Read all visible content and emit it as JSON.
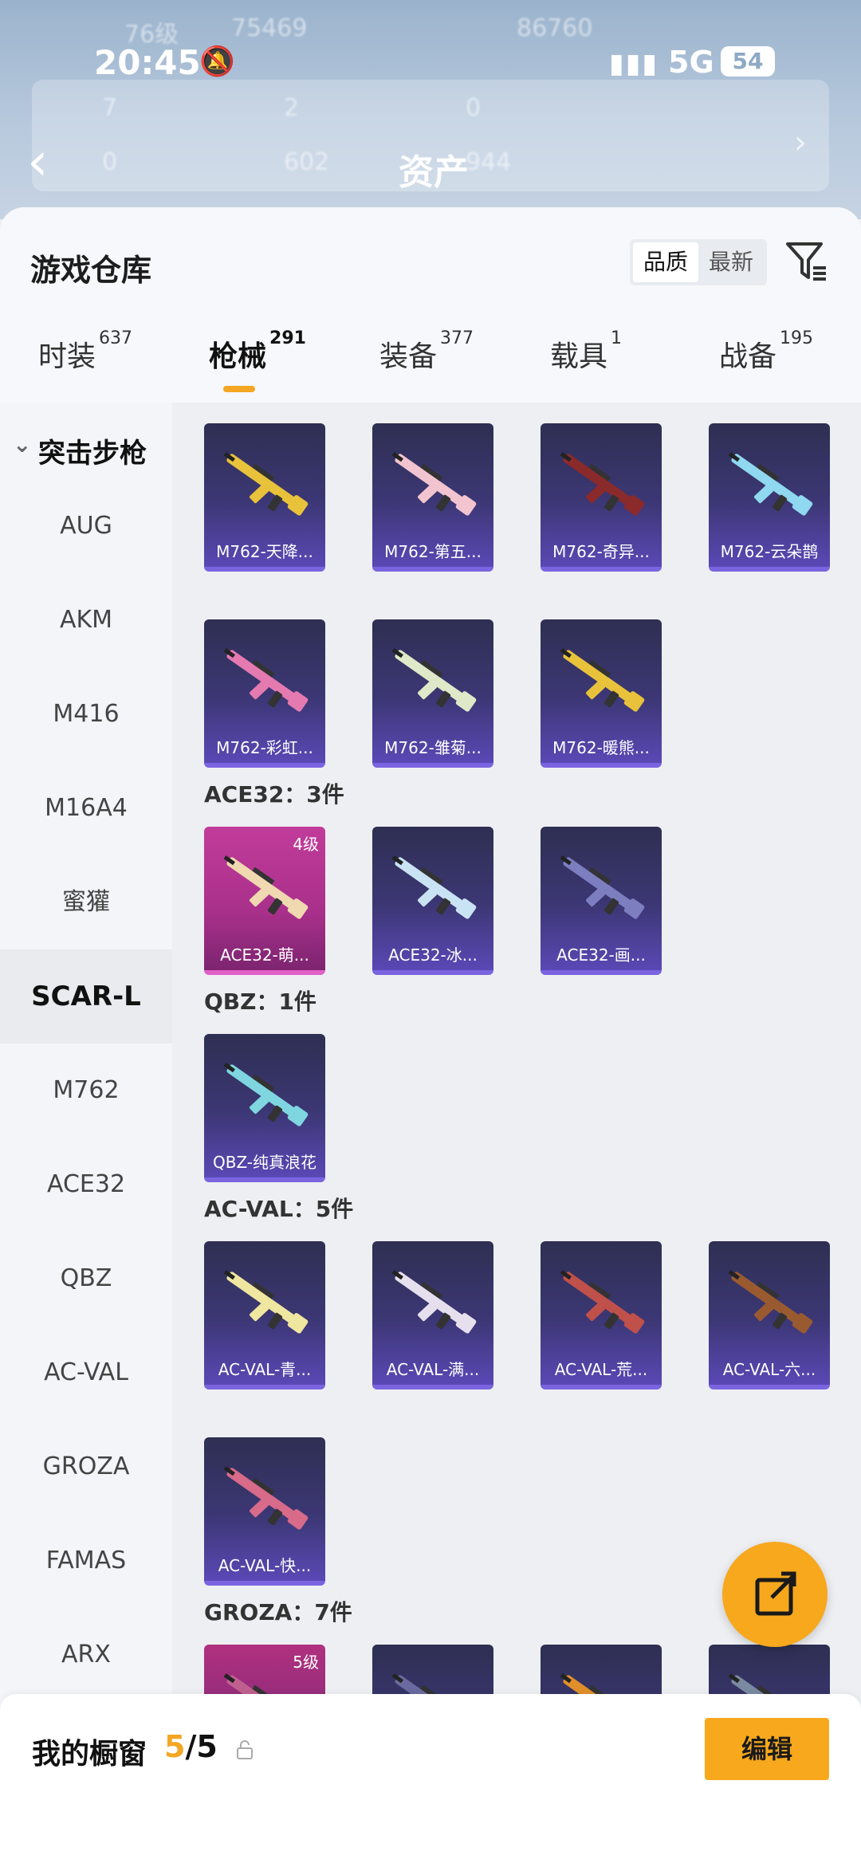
{
  "status_bar": {
    "time": "20:45",
    "network": "5G",
    "battery": "54"
  },
  "header": {
    "title": "资产",
    "ghost_level": "76级",
    "ghost_coins": "75469",
    "ghost_points": "86760",
    "stats": [
      "7",
      "2",
      "0",
      "0",
      "602",
      "944"
    ]
  },
  "warehouse": {
    "title": "游戏仓库",
    "sort_options": [
      "品质",
      "最新"
    ]
  },
  "tabs": [
    {
      "label": "时装",
      "count": "637"
    },
    {
      "label": "枪械",
      "count": "291"
    },
    {
      "label": "装备",
      "count": "377"
    },
    {
      "label": "载具",
      "count": "1"
    },
    {
      "label": "战备",
      "count": "195"
    }
  ],
  "sidebar": {
    "category": "突击步枪",
    "items": [
      "AUG",
      "AKM",
      "M416",
      "M16A4",
      "蜜獾",
      "SCAR-L",
      "M762",
      "ACE32",
      "QBZ",
      "AC-VAL",
      "GROZA",
      "FAMAS",
      "ARX"
    ]
  },
  "sections": [
    {
      "title": "",
      "items": [
        {
          "label": "M762-天降...",
          "color": "#e8c23a"
        },
        {
          "label": "M762-第五...",
          "color": "#f2c4cf"
        },
        {
          "label": "M762-奇异...",
          "color": "#8a2a2a"
        },
        {
          "label": "M762-云朵鹊",
          "color": "#8fd8f0"
        },
        {
          "label": "M762-彩虹...",
          "color": "#e57ab0"
        },
        {
          "label": "M762-雏菊...",
          "color": "#dfe8c8"
        },
        {
          "label": "M762-暖熊...",
          "color": "#e8c23a"
        }
      ]
    },
    {
      "title": "ACE32：3件",
      "items": [
        {
          "label": "ACE32-萌...",
          "color": "#f0d8b0",
          "level": "4级"
        },
        {
          "label": "ACE32-冰...",
          "color": "#c9e3f5"
        },
        {
          "label": "ACE32-画...",
          "color": "#7c7ec0"
        }
      ]
    },
    {
      "title": "QBZ：1件",
      "items": [
        {
          "label": "QBZ-纯真浪花",
          "color": "#7fd6e0"
        }
      ]
    },
    {
      "title": "AC-VAL：5件",
      "items": [
        {
          "label": "AC-VAL-青...",
          "color": "#efe6a0"
        },
        {
          "label": "AC-VAL-满...",
          "color": "#e6e0ee"
        },
        {
          "label": "AC-VAL-荒...",
          "color": "#c0504a"
        },
        {
          "label": "AC-VAL-六...",
          "color": "#9a5a30"
        },
        {
          "label": "AC-VAL-快...",
          "color": "#d86a8a"
        }
      ]
    },
    {
      "title": "GROZA：7件",
      "items": [
        {
          "label": "",
          "color": "#c06090",
          "level": "5级"
        },
        {
          "label": "",
          "color": "#6a6aa0"
        },
        {
          "label": "",
          "color": "#e0902a"
        },
        {
          "label": "",
          "color": "#7a8aa0"
        }
      ]
    }
  ],
  "showcase": {
    "title": "我的橱窗",
    "current": "5",
    "total": "/5",
    "edit_label": "编辑"
  },
  "colors": {
    "accent": "#f7a81c",
    "card_bg": "#3c3775"
  },
  "icons": [
    "back-icon",
    "bell-mute-icon",
    "signal-icon",
    "filter-icon",
    "share-edit-icon",
    "lock-icon",
    "chevron-down-icon",
    "gun-icon"
  ]
}
